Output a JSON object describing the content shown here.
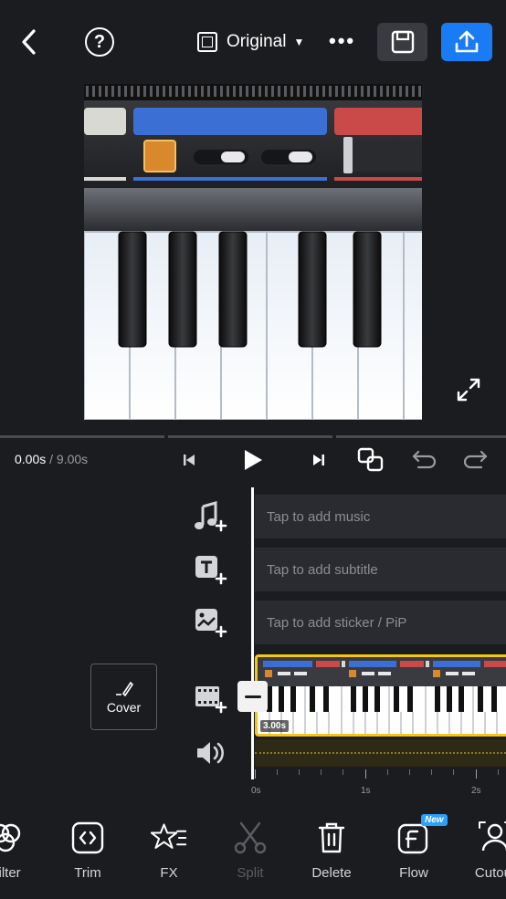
{
  "topbar": {
    "help_glyph": "?",
    "aspect_label": "Original",
    "more_glyph": "•••"
  },
  "playback": {
    "current_time": "0.00s",
    "total_time": " / 9.00s"
  },
  "tracks": {
    "music_placeholder": "Tap to add music",
    "subtitle_placeholder": "Tap to add subtitle",
    "sticker_placeholder": "Tap to add sticker / PiP",
    "cover_label": "Cover",
    "clip_duration": "3.00s"
  },
  "ruler": {
    "labels": [
      "0s",
      "1s",
      "2s"
    ]
  },
  "toolbar": {
    "items": [
      {
        "label": "Filter",
        "icon": "filter-icon",
        "enabled": true
      },
      {
        "label": "Trim",
        "icon": "trim-icon",
        "enabled": true
      },
      {
        "label": "FX",
        "icon": "fx-icon",
        "enabled": true
      },
      {
        "label": "Split",
        "icon": "scissors-icon",
        "enabled": false
      },
      {
        "label": "Delete",
        "icon": "trash-icon",
        "enabled": true
      },
      {
        "label": "Flow",
        "icon": "flow-icon",
        "enabled": true,
        "badge": "New"
      },
      {
        "label": "Cutout",
        "icon": "cutout-icon",
        "enabled": true
      }
    ]
  },
  "colors": {
    "background": "#1b1c1f",
    "accent_blue": "#1a7cf5",
    "clip_border": "#f5c518",
    "badge_blue": "#2aa0ff"
  }
}
